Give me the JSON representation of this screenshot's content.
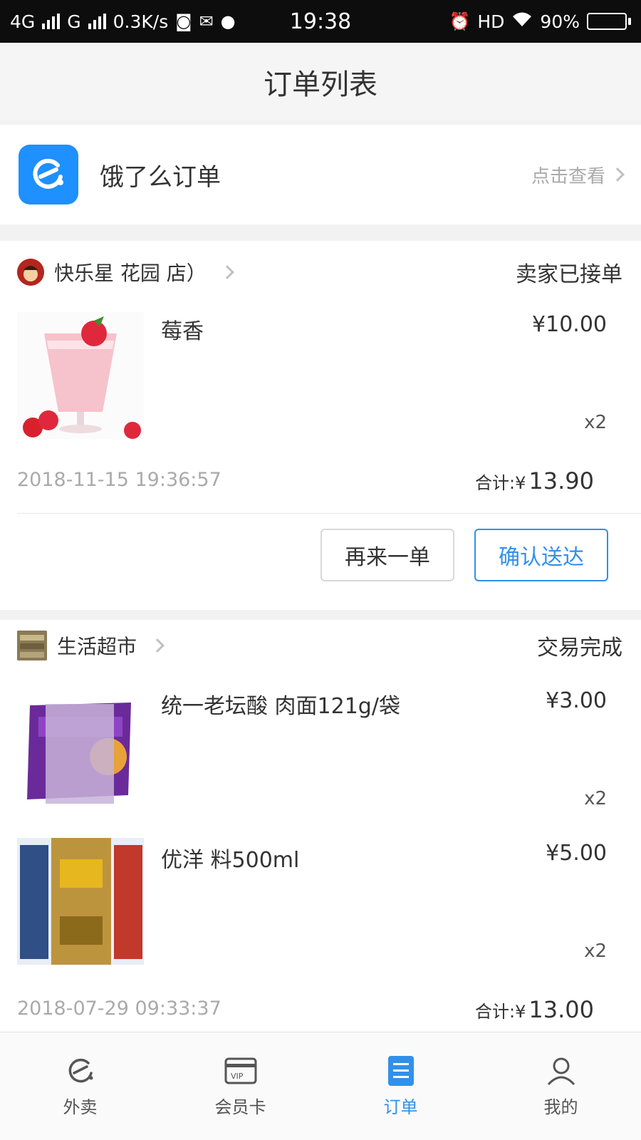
{
  "status_bar": {
    "network1": "4G",
    "network2": "G",
    "speed": "0.3K/s",
    "time": "19:38",
    "hd": "HD",
    "battery": "90%",
    "battery_level": 0.9
  },
  "header": {
    "title": "订单列表"
  },
  "ele_entry": {
    "title": "饿了么订单",
    "link": "点击查看"
  },
  "orders": [
    {
      "shop_name": "快乐星 花园 店）",
      "status": "卖家已接单",
      "items": [
        {
          "name": "莓香",
          "price": "¥10.00",
          "qty": "x2"
        }
      ],
      "time": "2018-11-15 19:36:57",
      "total_label": "合计:¥",
      "total_value": "13.90",
      "buttons": {
        "reorder": "再来一单",
        "confirm": "确认送达"
      }
    },
    {
      "shop_name": "生活超市",
      "status": "交易完成",
      "items": [
        {
          "name": "统一老坛酸 肉面121g/袋",
          "price": "¥3.00",
          "qty": "x2"
        },
        {
          "name": "优洋 料500ml",
          "price": "¥5.00",
          "qty": "x2"
        }
      ],
      "time": "2018-07-29 09:33:37",
      "total_label": "合计:¥",
      "total_value": "13.00"
    }
  ],
  "tabs": [
    {
      "label": "外卖",
      "icon": "eleme-icon",
      "active": false
    },
    {
      "label": "会员卡",
      "icon": "vip-card-icon",
      "active": false
    },
    {
      "label": "订单",
      "icon": "order-list-icon",
      "active": true
    },
    {
      "label": "我的",
      "icon": "profile-icon",
      "active": false
    }
  ],
  "colors": {
    "accent": "#3190e8",
    "ele_blue": "#1e90ff"
  }
}
